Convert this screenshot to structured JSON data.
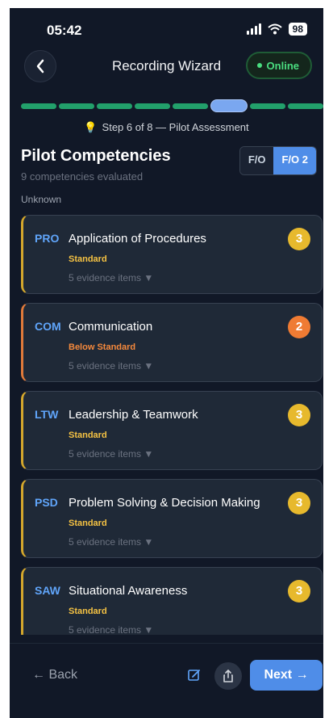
{
  "status_bar": {
    "time": "05:42",
    "battery": "98"
  },
  "header": {
    "title": "Recording Wizard",
    "online_label": "Online"
  },
  "progress": {
    "total_steps": 8,
    "current_step": 6
  },
  "step_text": "Step 6 of 8 — Pilot Assessment",
  "section": {
    "title": "Pilot Competencies",
    "subtitle": "9 competencies evaluated",
    "crew_label": "Unknown"
  },
  "toggle": {
    "option1": "F/O",
    "option2": "F/O 2",
    "selected": "F/O 2"
  },
  "competencies": [
    {
      "code": "PRO",
      "name": "Application of Procedures",
      "status": "Standard",
      "evidence": "5 evidence items ▼",
      "score": "3",
      "status_color": "#f6c343",
      "badge_color": "#e7b92d",
      "accent": "#d4a72c"
    },
    {
      "code": "COM",
      "name": "Communication",
      "status": "Below Standard",
      "evidence": "5 evidence items ▼",
      "score": "2",
      "status_color": "#f5893c",
      "badge_color": "#ef7b33",
      "accent": "#e07a3a"
    },
    {
      "code": "LTW",
      "name": "Leadership & Teamwork",
      "status": "Standard",
      "evidence": "5 evidence items ▼",
      "score": "3",
      "status_color": "#f6c343",
      "badge_color": "#e7b92d",
      "accent": "#d4a72c"
    },
    {
      "code": "PSD",
      "name": "Problem Solving & Decision Making",
      "status": "Standard",
      "evidence": "5 evidence items ▼",
      "score": "3",
      "status_color": "#f6c343",
      "badge_color": "#e7b92d",
      "accent": "#d4a72c"
    },
    {
      "code": "SAW",
      "name": "Situational Awareness",
      "status": "Standard",
      "evidence": "5 evidence items ▼",
      "score": "3",
      "status_color": "#f6c343",
      "badge_color": "#e7b92d",
      "accent": "#d4a72c"
    }
  ],
  "footer": {
    "back_label": "← Back",
    "next_label": "Next →"
  },
  "icons": [
    "chevron-left-icon",
    "signal-icon",
    "wifi-icon",
    "battery-icon",
    "lightbulb-icon",
    "edit-icon",
    "share-icon"
  ]
}
